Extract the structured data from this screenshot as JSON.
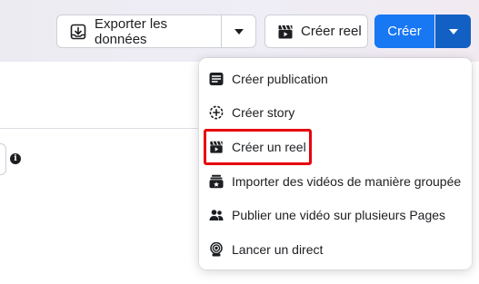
{
  "toolbar": {
    "export_label": "Exporter les données",
    "export_icon": "download-box-icon",
    "reel_label": "Créer reel",
    "reel_icon": "clapperboard-icon",
    "create_label": "Créer",
    "caret_icon": "caret-down-icon"
  },
  "menu": {
    "items": [
      {
        "label": "Créer publication",
        "icon": "post-icon"
      },
      {
        "label": "Créer story",
        "icon": "story-plus-icon"
      },
      {
        "label": "Créer un reel",
        "icon": "clapperboard-icon"
      },
      {
        "label": "Importer des vidéos de manière groupée",
        "icon": "video-stack-icon"
      },
      {
        "label": "Publier une vidéo sur plusieurs Pages",
        "icon": "people-icon"
      },
      {
        "label": "Lancer un direct",
        "icon": "live-icon"
      }
    ],
    "highlighted_index": 2
  },
  "colors": {
    "primary": "#1877f2",
    "primary_dark": "#1260c4",
    "highlight_border": "#e8000d",
    "text": "#1c1e21"
  }
}
